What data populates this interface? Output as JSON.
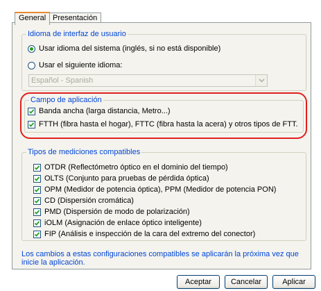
{
  "tabs": [
    {
      "label": "General",
      "active": true
    },
    {
      "label": "Presentación",
      "active": false
    }
  ],
  "language_group": {
    "title": "Idioma de interfaz de usuario",
    "option_system": {
      "label": "Usar idioma del sistema (inglés, si no está disponible)",
      "selected": true
    },
    "option_custom": {
      "label": "Usar el siguiente idioma:",
      "selected": false
    },
    "language_select": {
      "value": "Español - Spanish",
      "enabled": false
    }
  },
  "application_group": {
    "title": "Campo de aplicación",
    "items": [
      {
        "label": "Banda ancha (larga distancia, Metro...)",
        "checked": true
      },
      {
        "label": "FTTH (fibra hasta el hogar), FTTC (fibra hasta la acera) y otros tipos de FTT.",
        "checked": true
      }
    ]
  },
  "measurements_group": {
    "title": "Tipos de mediciones compatibles",
    "items": [
      {
        "label": "OTDR (Reflectómetro óptico en el dominio del tiempo)",
        "checked": true
      },
      {
        "label": "OLTS (Conjunto para pruebas de pérdida óptica)",
        "checked": true
      },
      {
        "label": "OPM (Medidor de potencia óptica), PPM (Medidor de potencia PON)",
        "checked": true
      },
      {
        "label": "CD (Dispersión cromática)",
        "checked": true
      },
      {
        "label": "PMD (Dispersión de modo de polarización)",
        "checked": true
      },
      {
        "label": "iOLM (Asignación de enlace óptico inteligente)",
        "checked": true
      },
      {
        "label": "FIP (Análisis e inspección de la cara del extremo del conector)",
        "checked": true
      }
    ]
  },
  "notice": "Los cambios a estas configuraciones compatibles se aplicarán la próxima vez que inicie la aplicación.",
  "buttons": {
    "accept": "Aceptar",
    "cancel": "Cancelar",
    "apply": "Aplicar"
  },
  "colors": {
    "legend": "#0046d5",
    "highlight": "#e0201e",
    "check": "#21a121"
  }
}
